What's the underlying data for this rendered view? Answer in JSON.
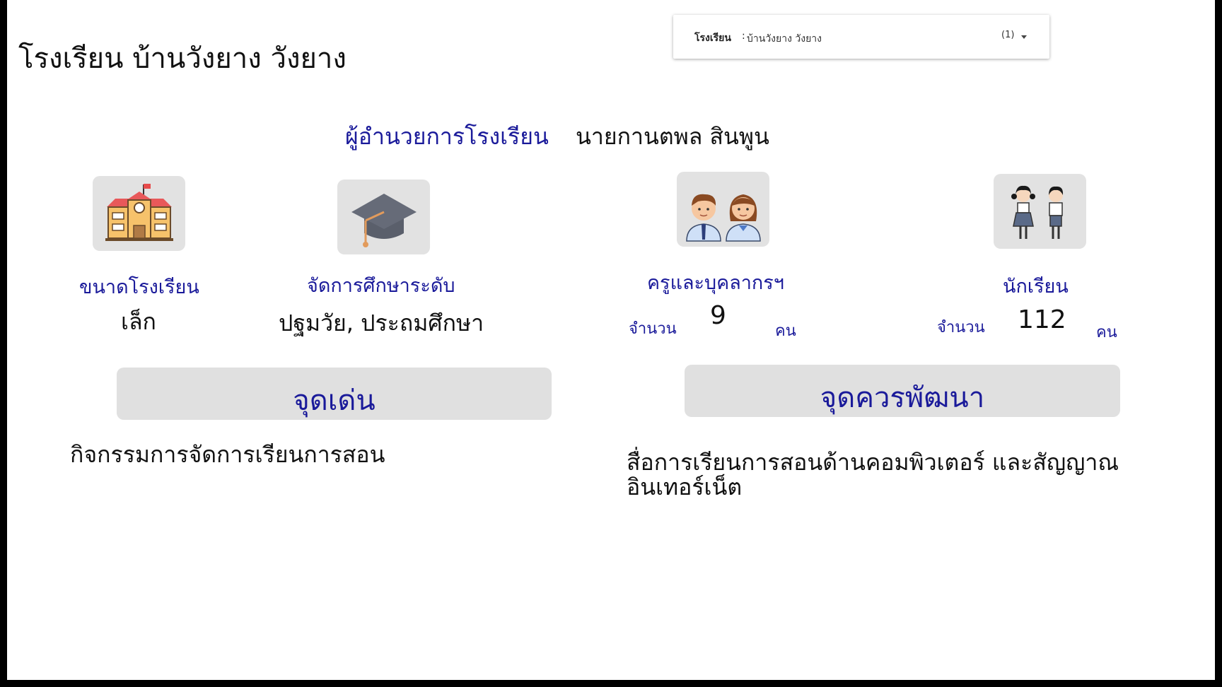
{
  "page": {
    "title": "โรงเรียน บ้านวังยาง วังยาง"
  },
  "filter": {
    "label": "โรงเรียน",
    "separator": ":",
    "value": "บ้านวังยาง วังยาง",
    "count": "(1)"
  },
  "director": {
    "label": "ผู้อำนวยการโรงเรียน",
    "name": "นายกานตพล สินพูน"
  },
  "stats": {
    "school_size": {
      "icon": "school-building-icon",
      "label": "ขนาดโรงเรียน",
      "value": "เล็ก"
    },
    "education_level": {
      "icon": "graduation-cap-icon",
      "label": "จัดการศึกษาระดับ",
      "value": "ปฐมวัย, ประถมศึกษา"
    },
    "teachers": {
      "icon": "teachers-icon",
      "label": "ครูและบุคลากรฯ",
      "count_label": "จำนวน",
      "count": "9",
      "unit": "คน"
    },
    "students": {
      "icon": "students-icon",
      "label": "นักเรียน",
      "count_label": "จำนวน",
      "count": "112",
      "unit": "คน"
    }
  },
  "strengths": {
    "heading": "จุดเด่น",
    "text": "กิจกรรมการจัดการเรียนการสอน"
  },
  "improvements": {
    "heading": "จุดควรพัฒนา",
    "text_line1": "สื่อการเรียนการสอนด้านคอมพิวเตอร์ และสัญญาณ",
    "text_line2": "อินเทอร์เน็ต"
  },
  "colors": {
    "accent": "#1a1a9a",
    "panel": "#e0e0e0",
    "frame": "#000000"
  }
}
